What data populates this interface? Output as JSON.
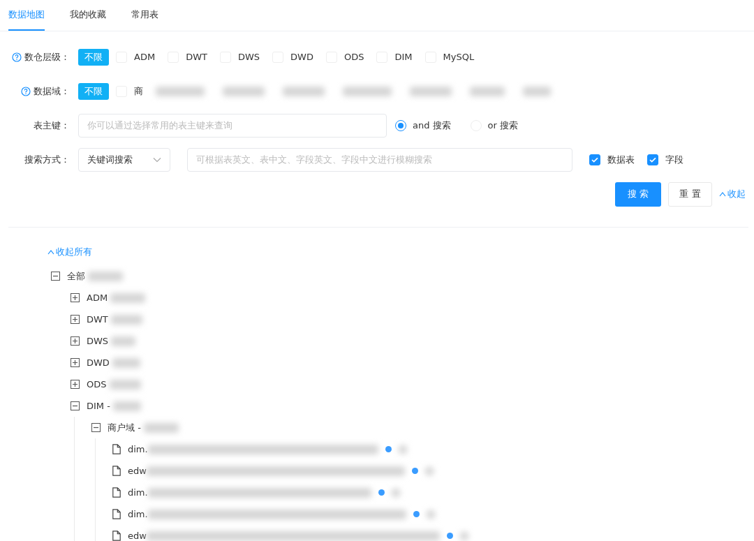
{
  "tabs": [
    {
      "label": "数据地图",
      "selected": true
    },
    {
      "label": "我的收藏",
      "selected": false
    },
    {
      "label": "常用表",
      "selected": false
    }
  ],
  "layer_filter": {
    "label": "数仓层级：",
    "all_option": {
      "label": "不限",
      "selected": true
    },
    "options": [
      {
        "label": "ADM",
        "checked": false
      },
      {
        "label": "DWT",
        "checked": false
      },
      {
        "label": "DWS",
        "checked": false
      },
      {
        "label": "DWD",
        "checked": false
      },
      {
        "label": "ODS",
        "checked": false
      },
      {
        "label": "DIM",
        "checked": false
      },
      {
        "label": "MySQL",
        "checked": false
      }
    ]
  },
  "domain_filter": {
    "label": "数据域：",
    "all_option": {
      "label": "不限",
      "selected": true
    },
    "options": [
      {
        "label": "商",
        "checked": false
      }
    ]
  },
  "table_key": {
    "label": "表主键：",
    "placeholder": "你可以通过选择常用的表主键来查询",
    "radios": [
      {
        "label": "and 搜索",
        "selected": true
      },
      {
        "label": "or 搜索",
        "selected": false
      }
    ]
  },
  "search_mode": {
    "label": "搜索方式：",
    "select_value": "关键词搜索",
    "placeholder": "可根据表英文、表中文、字段英文、字段中文进行模糊搜索",
    "checkboxes": [
      {
        "label": "数据表",
        "checked": true
      },
      {
        "label": "字段",
        "checked": true
      }
    ]
  },
  "actions": {
    "search": "搜 索",
    "reset": "重 置",
    "collapse": "收起"
  },
  "tree": {
    "collapse_all": "收起所有",
    "root": {
      "label": "全部",
      "expanded": true,
      "children": [
        {
          "label": "ADM",
          "expanded": false
        },
        {
          "label": "DWT",
          "expanded": false
        },
        {
          "label": "DWS",
          "expanded": false
        },
        {
          "label": "DWD",
          "expanded": false
        },
        {
          "label": "ODS",
          "expanded": false
        },
        {
          "label": "DIM -",
          "expanded": true,
          "children": [
            {
              "label": "商户域 -",
              "expanded": true,
              "children": [
                {
                  "label": "dim."
                },
                {
                  "label": "edw"
                },
                {
                  "label": "dim."
                },
                {
                  "label": "dim."
                },
                {
                  "label": "edw"
                }
              ]
            }
          ]
        }
      ]
    }
  }
}
